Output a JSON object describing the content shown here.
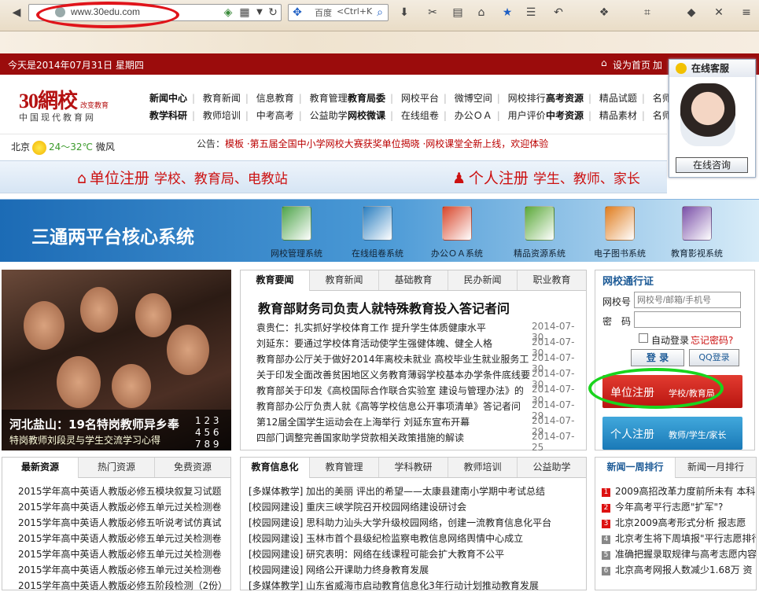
{
  "browser": {
    "url": "www.30edu.com",
    "search_engine": "百度",
    "search_placeholder": "<Ctrl+K"
  },
  "date_bar": {
    "date_text": "今天是2014年07月31日 星期四",
    "homepage_link": "设为首页",
    "favorite_link": "加"
  },
  "logo": {
    "main": "30網校",
    "slogan": "改变教育",
    "subtitle": "中国现代教育网"
  },
  "nav": {
    "row1": [
      {
        "head": "新闻中心",
        "items": [
          "教育新闻",
          "信息教育",
          "教育管理"
        ]
      },
      {
        "head": "教育局委",
        "items": [
          "网校平台",
          "微博空间",
          "网校排行"
        ]
      },
      {
        "head": "高考资源",
        "items": [
          "精品试题",
          "名师课"
        ]
      }
    ],
    "row2": [
      {
        "head": "教学科研",
        "items": [
          "教师培训",
          "中考高考",
          "公益助学"
        ]
      },
      {
        "head": "网校微课",
        "items": [
          "在线组卷",
          "办公ＯＡ",
          "用户评价"
        ]
      },
      {
        "head": "中考资源",
        "items": [
          "精品素材",
          "名师教"
        ]
      }
    ]
  },
  "weather": {
    "city": "北京",
    "temp": "24～32℃",
    "wind": "微风"
  },
  "notice": {
    "label": "公告：",
    "text": "模板 ·第五届全国中小学网校大赛获奖单位揭晓 ·网校课堂全新上线，欢迎体验"
  },
  "register": {
    "unit_title": "单位注册",
    "unit_sub": "学校、教育局、电教站",
    "person_title": "个人注册",
    "person_sub": "学生、教师、家长"
  },
  "banner": {
    "title": "三通两平台核心系统",
    "systems": [
      {
        "label": "网校管理系统",
        "color": "#4ea44a"
      },
      {
        "label": "在线组卷系统",
        "color": "#2b7fc0"
      },
      {
        "label": "办公ＯＡ系统",
        "color": "#d8462b"
      },
      {
        "label": "精品资源系统",
        "color": "#5aa838"
      },
      {
        "label": "电子图书系统",
        "color": "#e07d1e"
      },
      {
        "label": "教育影视系统",
        "color": "#7a4fa8"
      }
    ]
  },
  "chat": {
    "title": "在线客服",
    "button": "在线咨询"
  },
  "photo": {
    "title": "河北盐山：19名特岗教师异乡奉",
    "subtitle": "特岗教师刘段灵与学生交流学习心得",
    "numbers": [
      "1 2 3",
      "4 5 6",
      "7 8 9"
    ]
  },
  "news": {
    "tabs": [
      "教育要闻",
      "教育新闻",
      "基础教育",
      "民办新闻",
      "职业教育"
    ],
    "headline": "教育部财务司负责人就特殊教育投入答记者问",
    "items": [
      {
        "text": "袁贵仁：扎实抓好学校体育工作 提升学生体质健康水平",
        "date": "2014-07-30"
      },
      {
        "text": "刘延东：要通过学校体育活动使学生强健体魄、健全人格",
        "date": "2014-07-30"
      },
      {
        "text": "教育部办公厅关于做好2014年离校未就业 高校毕业生就业服务工",
        "date": "2014-07-30"
      },
      {
        "text": "关于印发全面改善贫困地区义务教育薄弱学校基本办学条件底线要",
        "date": "2014-07-30"
      },
      {
        "text": "教育部关于印发《高校国际合作联合实验室 建设与管理办法》的",
        "date": "2014-07-30"
      },
      {
        "text": "教育部办公厅负责人就《高等学校信息公开事项清单》答记者问",
        "date": "2014-07-29"
      },
      {
        "text": "第12届全国学生运动会在上海举行 刘延东宣布开幕",
        "date": "2014-07-29"
      },
      {
        "text": "四部门调整完善国家助学贷款相关政策措施的解读",
        "date": "2014-07-25"
      }
    ]
  },
  "login": {
    "title": "网校通行证",
    "account_label": "网校号",
    "account_placeholder": "网校号/邮箱/手机号",
    "password_label": "密　码",
    "auto_login": "自动登录",
    "forgot": "忘记密码?",
    "login_button": "登 录",
    "qq_button": "QQ登录",
    "unit_register": "单位注册",
    "unit_register_sub": "学校/教育局",
    "person_register": "个人注册",
    "person_register_sub": "教师/学生/家长"
  },
  "resources": {
    "tabs": [
      "最新资源",
      "热门资源",
      "免费资源"
    ],
    "items": [
      "2015学年高中英语人教版必修五模块叙复习试题",
      "2015学年高中英语人教版必修五单元过关检测卷",
      "2015学年高中英语人教版必修五听说考试仿真试",
      "2015学年高中英语人教版必修五单元过关检测卷",
      "2015学年高中英语人教版必修五单元过关检测卷",
      "2015学年高中英语人教版必修五单元过关检测卷",
      "2015学年高中英语人教版必修五阶段检测（2份）"
    ]
  },
  "info": {
    "tabs": [
      "教育信息化",
      "教育管理",
      "学科教研",
      "教师培训",
      "公益助学"
    ],
    "items": [
      "[多媒体教学] 加出的美丽 评出的希望——太康县建南小学期中考试总结",
      "[校园网建设] 重庆三峡学院召开校园网络建设研讨会",
      "[校园网建设] 思科助力汕头大学升级校园网络，创建一流教育信息化平台",
      "[校园网建设] 玉林市首个县级纪检监察电教信息网络舆情中心成立",
      "[校园网建设] 研究表明：网络在线课程可能会扩大教育不公平",
      "[校园网建设] 网络公开课助力终身教育发展",
      "[多媒体教学] 山东省威海市启动教育信息化3年行动计划推动教育发展"
    ]
  },
  "ranking": {
    "tabs": [
      "新闻一周排行",
      "新闻一月排行"
    ],
    "items": [
      {
        "num": "1",
        "text": "2009高招改革力度前所未有 本科"
      },
      {
        "num": "2",
        "text": "今年高考平行志愿\"扩军\"?"
      },
      {
        "num": "3",
        "text": "北京2009高考形式分析 报志愿"
      },
      {
        "num": "4",
        "text": "北京考生将下周填报\"平行志愿排行\""
      },
      {
        "num": "5",
        "text": "准确把握录取规律与高考志愿内容"
      },
      {
        "num": "6",
        "text": "北京高考网报人数减少1.68万 资"
      }
    ]
  }
}
